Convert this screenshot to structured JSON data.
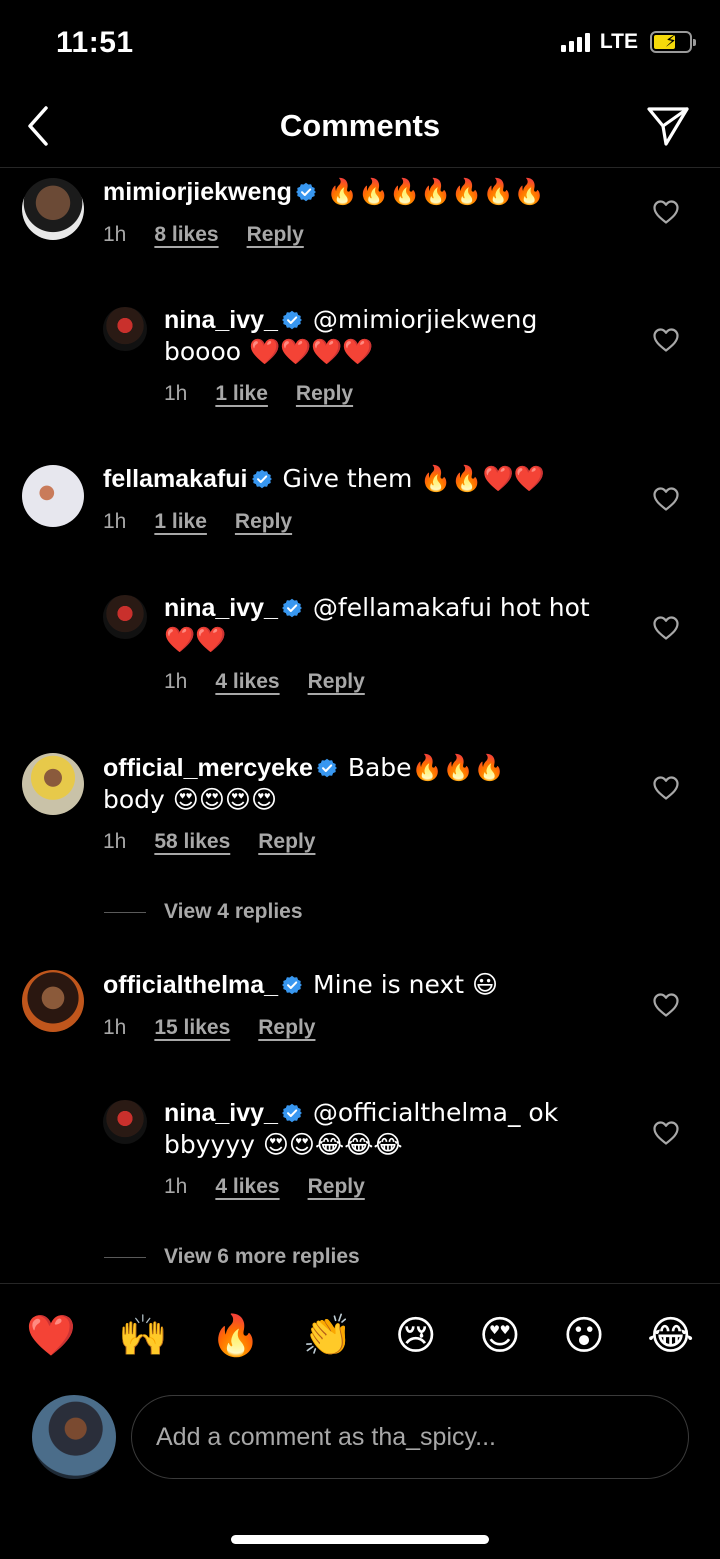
{
  "status_bar": {
    "time": "11:51",
    "network": "LTE",
    "battery_charging": true
  },
  "nav": {
    "title": "Comments"
  },
  "comments": [
    {
      "username": "mimiorjiekweng",
      "text": "🔥🔥🔥🔥🔥🔥🔥",
      "time": "1h",
      "likes": "8 likes",
      "reply": "Reply",
      "replies": [
        {
          "username": "nina_ivy_",
          "text": "@mimiorjiekweng boooo ❤️❤️❤️❤️",
          "time": "1h",
          "likes": "1 like",
          "reply": "Reply"
        }
      ]
    },
    {
      "username": "fellamakafui",
      "text": "Give them 🔥🔥❤️❤️",
      "time": "1h",
      "likes": "1 like",
      "reply": "Reply",
      "replies": [
        {
          "username": "nina_ivy_",
          "text": "@fellamakafui hot hot ❤️❤️",
          "time": "1h",
          "likes": "4 likes",
          "reply": "Reply"
        }
      ]
    },
    {
      "username": "official_mercyeke",
      "text": "Babe🔥🔥🔥 body 😍😍😍😍",
      "time": "1h",
      "likes": "58 likes",
      "reply": "Reply",
      "view_replies": "View 4 replies"
    },
    {
      "username": "officialthelma_",
      "text": "Mine is next 😃",
      "time": "1h",
      "likes": "15 likes",
      "reply": "Reply",
      "replies": [
        {
          "username": "nina_ivy_",
          "text": "@officialthelma_ ok bbyyyy 😍😍😂😂😂",
          "time": "1h",
          "likes": "4 likes",
          "reply": "Reply"
        }
      ],
      "view_replies": "View 6 more replies"
    }
  ],
  "emoji_bar": [
    "❤️",
    "🙌",
    "🔥",
    "👏",
    "😢",
    "😍",
    "😮",
    "😂"
  ],
  "composer": {
    "placeholder": "Add a comment as tha_spicy..."
  },
  "colors": {
    "background": "#000000",
    "secondary_text": "#a8a8a8",
    "verified": "#3897f0"
  }
}
